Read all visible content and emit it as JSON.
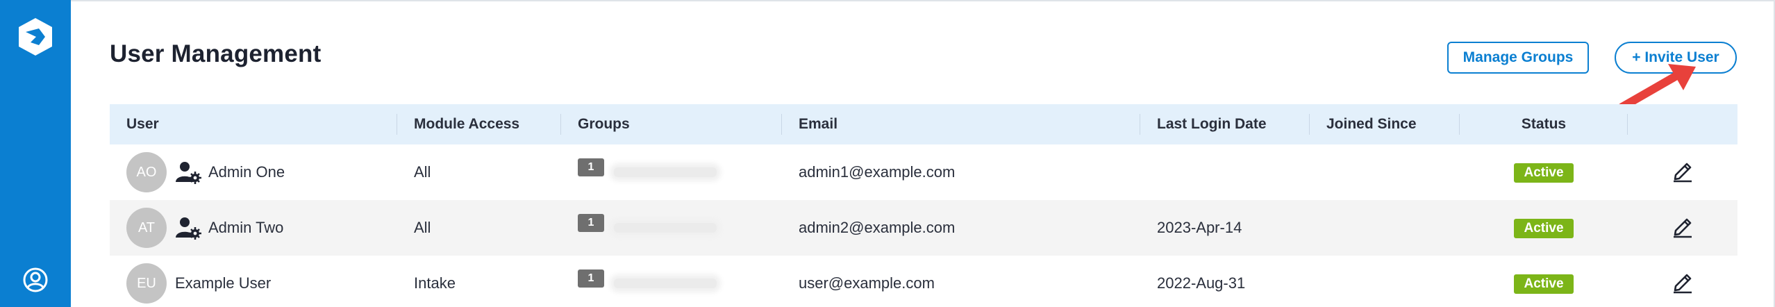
{
  "app": {
    "brand_color": "#0b7fd1",
    "logo_icon": "hexagon-logo-icon",
    "profile_icon": "user-circle-icon"
  },
  "header": {
    "title": "User Management",
    "manage_groups_label": "Manage Groups",
    "invite_user_label": "+ Invite User"
  },
  "annotation": {
    "arrow_color": "#e8413b",
    "points_to": "invite-user-button"
  },
  "table": {
    "columns": [
      "User",
      "Module Access",
      "Groups",
      "Email",
      "Last Login Date",
      "Joined Since",
      "Status",
      ""
    ],
    "rows": [
      {
        "initials": "AO",
        "name": "Admin One",
        "is_admin": true,
        "module_access": "All",
        "group_count": "1",
        "group_names": "[redacted]",
        "email": "admin1@example.com",
        "last_login": "",
        "joined_since": "",
        "status": "Active"
      },
      {
        "initials": "AT",
        "name": "Admin Two",
        "is_admin": true,
        "module_access": "All",
        "group_count": "1",
        "group_names": "[redacted]",
        "email": "admin2@example.com",
        "last_login": "2023-Apr-14",
        "joined_since": "",
        "status": "Active"
      },
      {
        "initials": "EU",
        "name": "Example User",
        "is_admin": false,
        "module_access": "Intake",
        "group_count": "1",
        "group_names": "[redacted]",
        "email": "user@example.com",
        "last_login": "2022-Aug-31",
        "joined_since": "",
        "status": "Active"
      }
    ]
  },
  "colors": {
    "status_active": "#7cb518",
    "header_row": "#e3f0fb",
    "avatar": "#c4c4c4"
  }
}
